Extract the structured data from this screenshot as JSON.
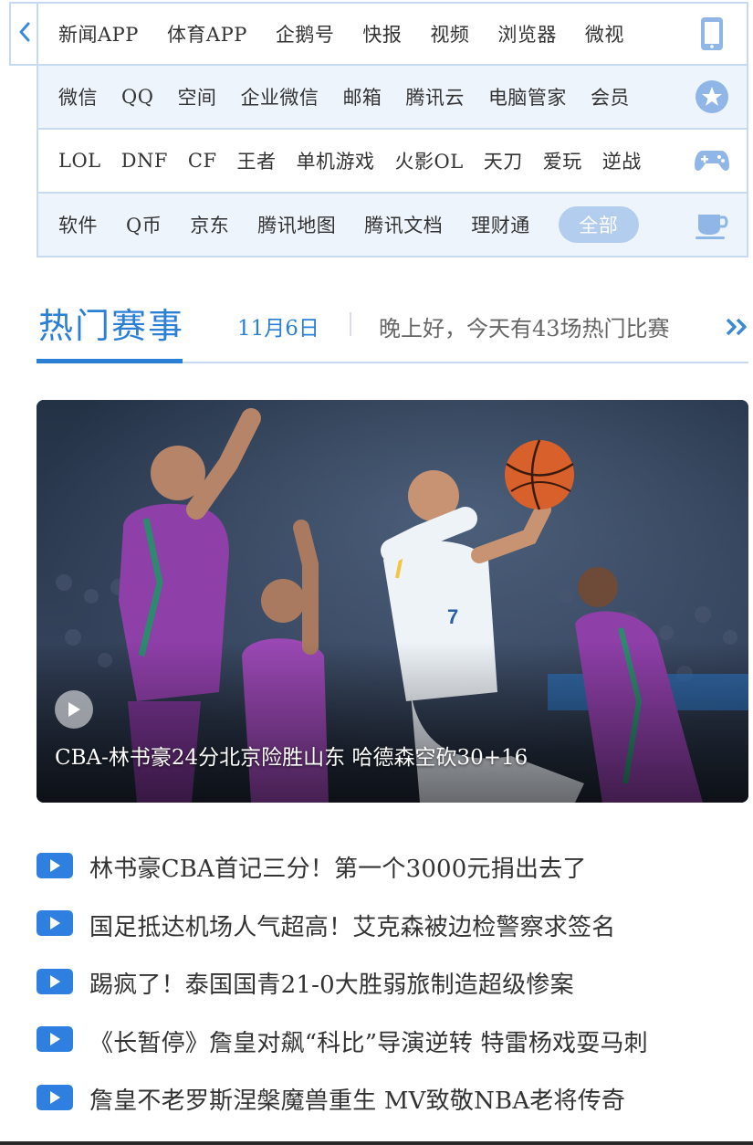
{
  "nav": {
    "rows": [
      {
        "icon": "phone-icon",
        "items": [
          "新闻APP",
          "体育APP",
          "企鹅号",
          "快报",
          "视频",
          "浏览器",
          "微视"
        ]
      },
      {
        "icon": "star-icon",
        "items": [
          "微信",
          "QQ",
          "空间",
          "企业微信",
          "邮箱",
          "腾讯云",
          "电脑管家",
          "会员"
        ]
      },
      {
        "icon": "gamepad-icon",
        "items": [
          "LOL",
          "DNF",
          "CF",
          "王者",
          "单机游戏",
          "火影OL",
          "天刀",
          "爱玩",
          "逆战"
        ]
      },
      {
        "icon": "cup-icon",
        "items": [
          "软件",
          "Q币",
          "京东",
          "腾讯地图",
          "腾讯文档",
          "理财通"
        ],
        "all_label": "全部"
      }
    ]
  },
  "hot": {
    "title": "热门赛事",
    "date": "11月6日",
    "greeting": "晚上好，今天有43场热门比赛"
  },
  "hero": {
    "caption": "CBA-林书豪24分北京险胜山东 哈德森空砍30+16"
  },
  "news": [
    "林书豪CBA首记三分！第一个3000元捐出去了",
    "国足抵达机场人气超高！艾克森被边检警察求签名",
    "踢疯了！泰国国青21-0大胜弱旅制造超级惨案",
    "《长暂停》詹皇对飙“科比”导演逆转 特雷杨戏耍马刺",
    "詹皇不老罗斯涅槃魔兽重生 MV致敬NBA老将传奇"
  ],
  "colors": {
    "accent": "#2b7fd4",
    "border": "#c8daef",
    "alt_row": "#eef4fc",
    "pill": "#b3cdef"
  }
}
